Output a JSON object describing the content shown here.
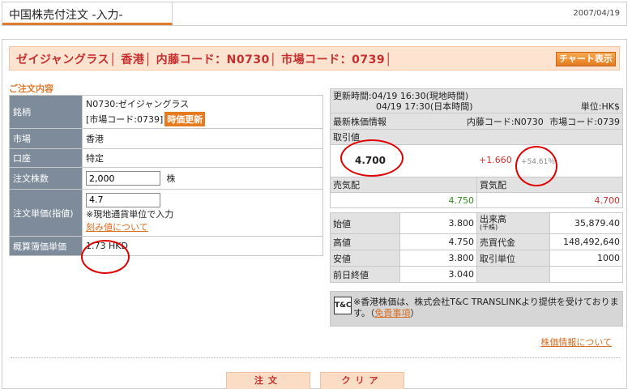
{
  "title": "中国株売付注文 -入力-",
  "date": "2007/04/19",
  "header": {
    "stock_line": "ゼイジャングラス│ 香港│ 内藤コード：N0730│ 市場コード：0739│",
    "chart_button": "チャート表示"
  },
  "order_section": {
    "heading": "ご注文内容",
    "rows": {
      "stock_label": "銘柄",
      "stock_name": "N0730:ゼイジャングラス",
      "market_code": "[市場コード:0739]",
      "refresh_button": "時価更新",
      "market_label": "市場",
      "market_value": "香港",
      "account_label": "口座",
      "account_value": "特定",
      "quantity_label": "注文株数",
      "quantity_value": "2,000",
      "quantity_unit": "株",
      "price_label": "注文単価(指値)",
      "price_value": "4.7",
      "price_note": "※現地通貨単位で入力",
      "tick_link": "刻み値について",
      "estimate_label": "概算簿価単価",
      "estimate_value": "1.73 HKD"
    }
  },
  "quote": {
    "updated_line1": "更新時間:04/19 16:30(現地時間)",
    "updated_line2": "04/19 17:30(日本時間)",
    "unit": "単位:HK$",
    "latest_label": "最新株価情報",
    "naito_code": "内藤コード:N0730",
    "market_code": "市場コード:0739",
    "last_label": "取引値",
    "last_price": "4.700",
    "change": "+1.660",
    "change_pct": "+54.61％",
    "ask_label": "売気配",
    "bid_label": "買気配",
    "ask_value": "4.750",
    "bid_value": "4.700",
    "stats": [
      {
        "l1": "始値",
        "v1": "3.800",
        "l2": "出来高",
        "l2sub": "(千株)",
        "v2": "35,879.40"
      },
      {
        "l1": "高値",
        "v1": "4.750",
        "l2": "売買代金",
        "l2sub": "",
        "v2": "148,492,640"
      },
      {
        "l1": "安値",
        "v1": "3.800",
        "l2": "取引単位",
        "l2sub": "",
        "v2": "1000"
      },
      {
        "l1": "前日終値",
        "v1": "3.040",
        "l2": "",
        "l2sub": "",
        "v2": ""
      }
    ]
  },
  "notice": {
    "logo": "T&C",
    "text": "※香港株価は、株式会社T&C TRANSLINKより提供を受けております。",
    "link": "免責事項",
    "paren_open": "（",
    "paren_close": "）"
  },
  "stock_info_link": "株価情報について",
  "buttons": {
    "order": "注文",
    "clear": "クリア"
  },
  "colors": {
    "accent": "#e07a2e",
    "header_bg": "#fde3d0",
    "label_bg": "#7e8b9b",
    "annotation": "#e00000"
  }
}
